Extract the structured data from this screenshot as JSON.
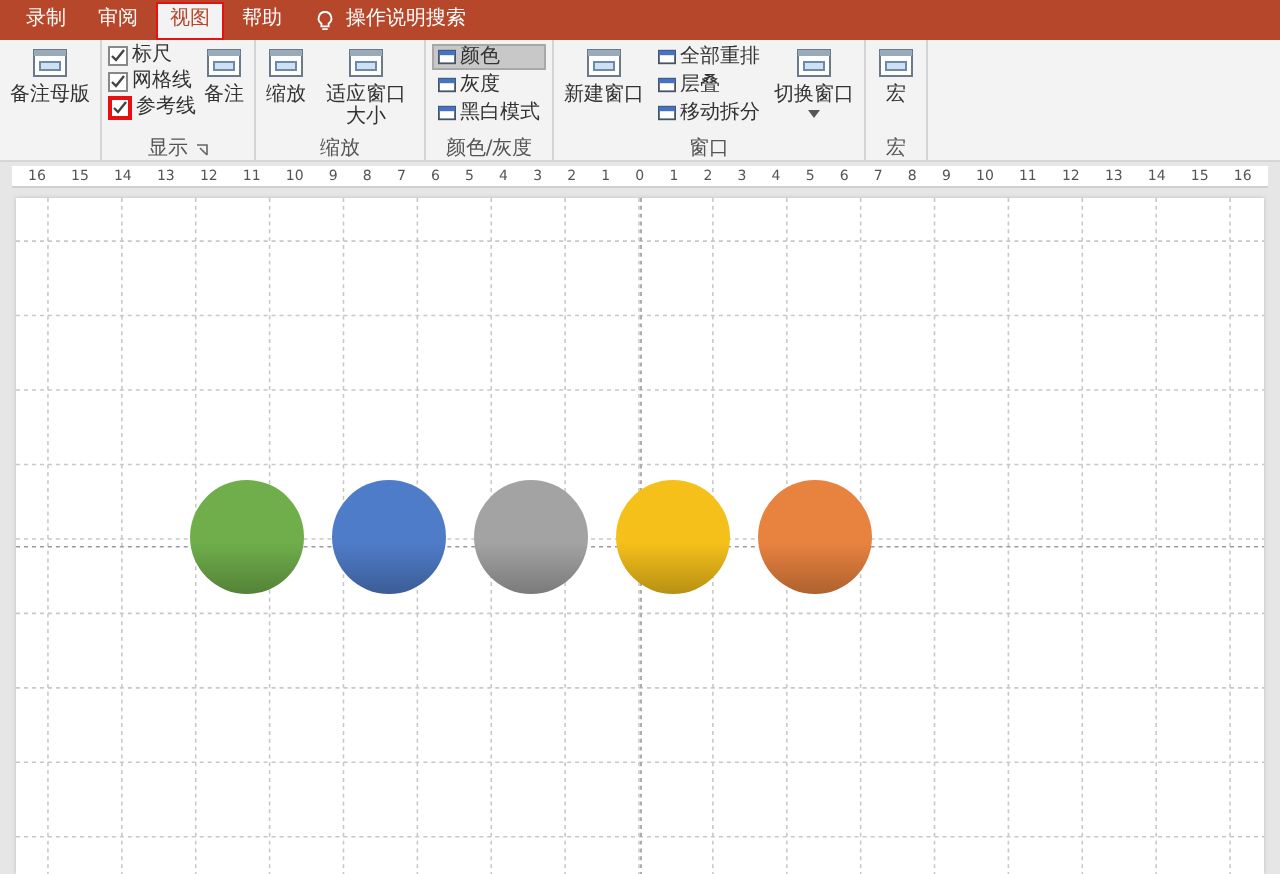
{
  "tabs": [
    {
      "label": "录制",
      "selected": false,
      "highlighted": false
    },
    {
      "label": "审阅",
      "selected": false,
      "highlighted": false
    },
    {
      "label": "视图",
      "selected": true,
      "highlighted": true
    },
    {
      "label": "帮助",
      "selected": false,
      "highlighted": false
    }
  ],
  "tell_me": "操作说明搜索",
  "ribbon_groups": [
    {
      "columns": [
        {
          "kind": "large",
          "label": "备注母版"
        }
      ]
    },
    {
      "label": "显示",
      "launcher": true,
      "columns": [
        {
          "kind": "stack",
          "items": [
            {
              "kind": "checkbox",
              "label": "标尺",
              "checked": true,
              "highlighted": false
            },
            {
              "kind": "checkbox",
              "label": "网格线",
              "checked": true,
              "highlighted": false
            },
            {
              "kind": "checkbox",
              "label": "参考线",
              "checked": true,
              "highlighted": true
            }
          ]
        },
        {
          "kind": "large",
          "label": "备注"
        }
      ]
    },
    {
      "label": "缩放",
      "columns": [
        {
          "kind": "large",
          "label": "缩放"
        },
        {
          "kind": "large",
          "label": "适应窗口大小"
        }
      ]
    },
    {
      "label": "颜色/灰度",
      "columns": [
        {
          "kind": "stack",
          "items": [
            {
              "kind": "small",
              "label": "颜色",
              "selected": true
            },
            {
              "kind": "small",
              "label": "灰度",
              "selected": false
            },
            {
              "kind": "small",
              "label": "黑白模式",
              "selected": false
            }
          ]
        }
      ]
    },
    {
      "label": "窗口",
      "columns": [
        {
          "kind": "large",
          "label": "新建窗口"
        },
        {
          "kind": "stack",
          "items": [
            {
              "kind": "small",
              "label": "全部重排",
              "selected": false
            },
            {
              "kind": "small",
              "label": "层叠",
              "selected": false
            },
            {
              "kind": "small",
              "label": "移动拆分",
              "selected": false
            }
          ]
        },
        {
          "kind": "large",
          "label": "切换窗口",
          "dropdown": true
        }
      ]
    },
    {
      "label": "宏",
      "columns": [
        {
          "kind": "large",
          "label": "宏"
        }
      ]
    }
  ],
  "ruler": [
    "16",
    "15",
    "14",
    "13",
    "12",
    "11",
    "10",
    "9",
    "8",
    "7",
    "6",
    "5",
    "4",
    "3",
    "2",
    "1",
    "0",
    "1",
    "2",
    "3",
    "4",
    "5",
    "6",
    "7",
    "8",
    "9",
    "10",
    "11",
    "12",
    "13",
    "14",
    "15",
    "16"
  ],
  "shapes": [
    {
      "kind": "circle",
      "color": "#6fae4a"
    },
    {
      "kind": "circle",
      "color": "#4f7cc8"
    },
    {
      "kind": "circle",
      "color": "#a3a3a3"
    },
    {
      "kind": "circle",
      "color": "#f5c01a"
    },
    {
      "kind": "circle",
      "color": "#e8823f"
    }
  ]
}
